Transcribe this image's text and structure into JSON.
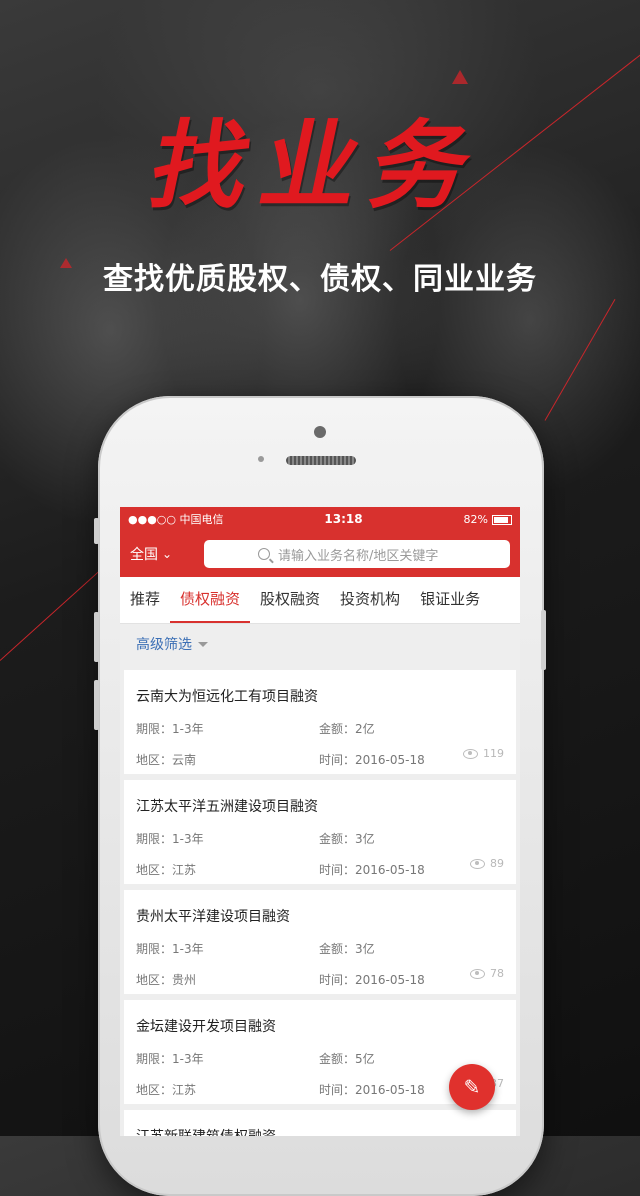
{
  "hero": {
    "title": "找业务",
    "subtitle": "查找优质股权、债权、同业业务"
  },
  "statusbar": {
    "carrier": "●●●○○ 中国电信",
    "time": "13:18",
    "battery": "82%"
  },
  "navbar": {
    "region": "全国",
    "search_placeholder": "请输入业务名称/地区关键字"
  },
  "tabs": [
    {
      "label": "推荐",
      "active": false
    },
    {
      "label": "债权融资",
      "active": true
    },
    {
      "label": "股权融资",
      "active": false
    },
    {
      "label": "投资机构",
      "active": false
    },
    {
      "label": "银证业务",
      "active": false
    }
  ],
  "filter_label": "高级筛选",
  "projects": [
    {
      "title": "云南大为恒远化工有项目融资",
      "term": "期限：1-3年",
      "amount": "金额：2亿",
      "region": "地区：云南",
      "time": "时间：2016-05-18",
      "views": "119"
    },
    {
      "title": "江苏太平洋五洲建设项目融资",
      "term": "期限：1-3年",
      "amount": "金额：3亿",
      "region": "地区：江苏",
      "time": "时间：2016-05-18",
      "views": "89"
    },
    {
      "title": "贵州太平洋建设项目融资",
      "term": "期限：1-3年",
      "amount": "金额：3亿",
      "region": "地区：贵州",
      "time": "时间：2016-05-18",
      "views": "78"
    },
    {
      "title": "金坛建设开发项目融资",
      "term": "期限：1-3年",
      "amount": "金额：5亿",
      "region": "地区：江苏",
      "time": "时间：2016-05-18",
      "views": "37"
    },
    {
      "title": "江苏新联建筑债权融资",
      "term": "",
      "amount": "",
      "region": "",
      "time": "",
      "views": ""
    }
  ],
  "colors": {
    "accent": "#d8312e",
    "hero_red": "#e0191f",
    "link_blue": "#3b6fb5"
  },
  "icons": {
    "search": "search-icon",
    "eye": "eye-icon",
    "edit": "pencil-icon",
    "chevron": "chevron-down-icon"
  }
}
